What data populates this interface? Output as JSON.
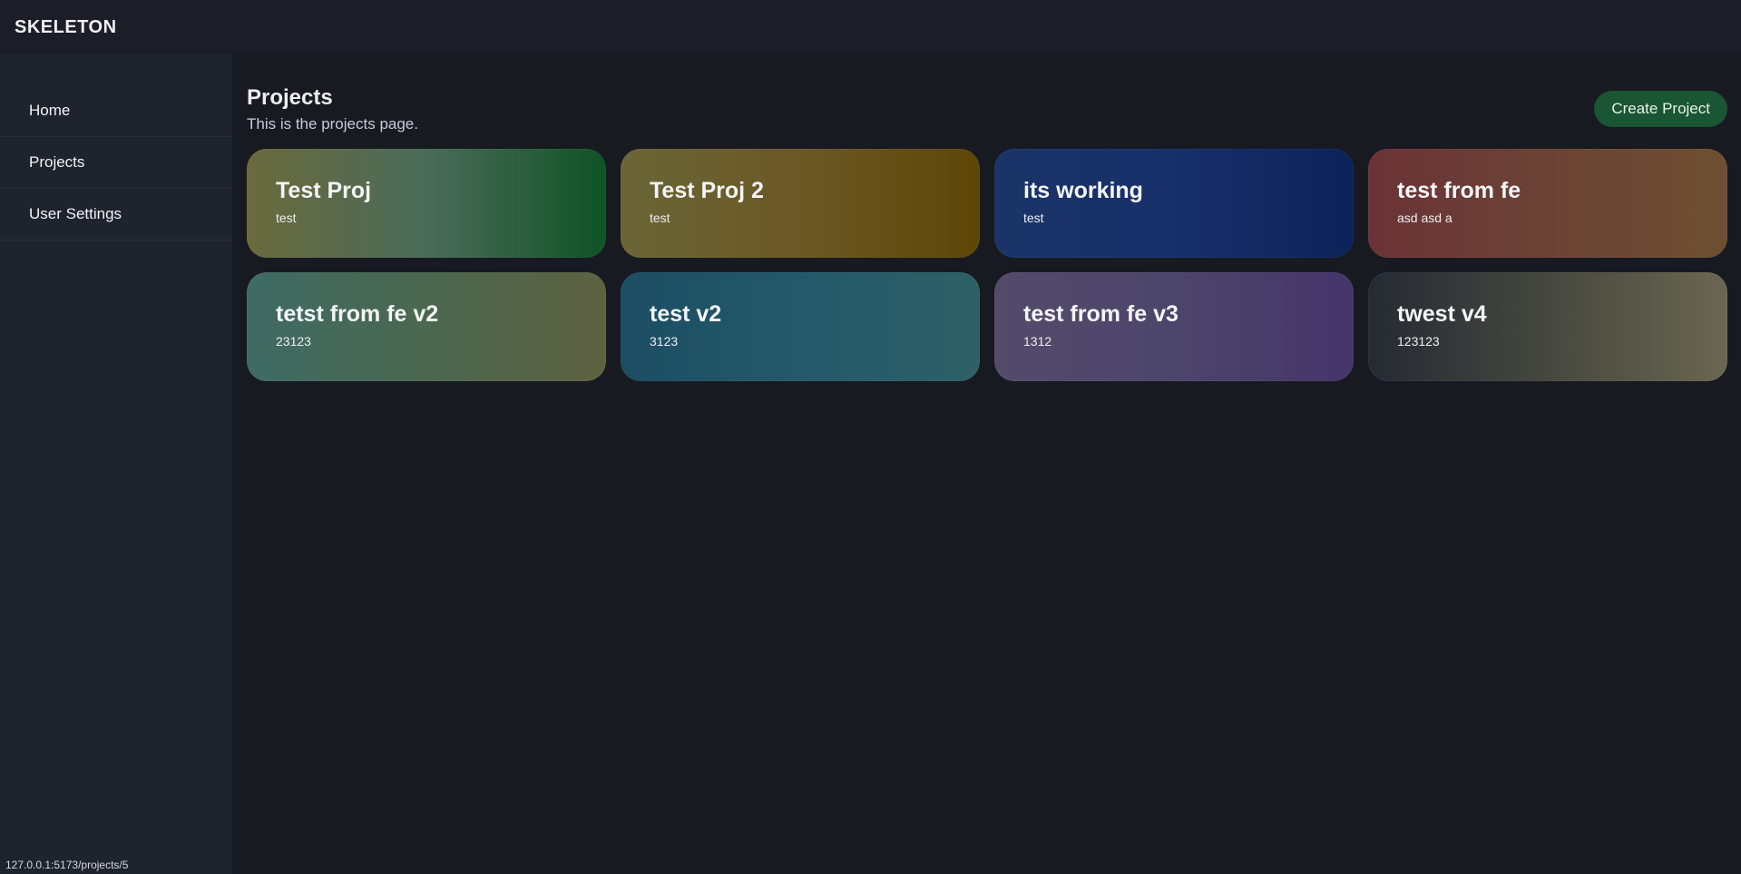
{
  "app": {
    "title": "SKELETON"
  },
  "sidebar": {
    "items": [
      {
        "label": "Home"
      },
      {
        "label": "Projects"
      },
      {
        "label": "User Settings"
      }
    ]
  },
  "page": {
    "title": "Projects",
    "subtitle": "This is the projects page.",
    "create_label": "Create Project"
  },
  "projects": [
    {
      "name": "Test Proj",
      "description": "test",
      "gradient": [
        "#6b6a3c",
        "#4a6b5a",
        "#0f5326"
      ]
    },
    {
      "name": "Test Proj 2",
      "description": "test",
      "gradient": [
        "#6a6537",
        "#6b5825",
        "#5e4607"
      ]
    },
    {
      "name": "its working",
      "description": "test",
      "gradient": [
        "#1a3468",
        "#172f6a",
        "#0c2359"
      ]
    },
    {
      "name": "test from fe",
      "description": "asd asd a",
      "gradient": [
        "#6b3236",
        "#6b4336",
        "#6e4f31"
      ]
    },
    {
      "name": "tetst from fe v2",
      "description": "23123",
      "gradient": [
        "#3e6b63",
        "#4b6750",
        "#5e6140"
      ]
    },
    {
      "name": "test v2",
      "description": "3123",
      "gradient": [
        "#1d4d63",
        "#23596a",
        "#2e6066"
      ]
    },
    {
      "name": "test from fe v3",
      "description": "1312",
      "gradient": [
        "#544b6b",
        "#4c456b",
        "#45356a"
      ]
    },
    {
      "name": "twest v4",
      "description": "123123",
      "gradient": [
        "#252a33",
        "#46483f",
        "#6a6651"
      ]
    }
  ],
  "statusbar": {
    "url": "127.0.0.1:5173/projects/5"
  }
}
